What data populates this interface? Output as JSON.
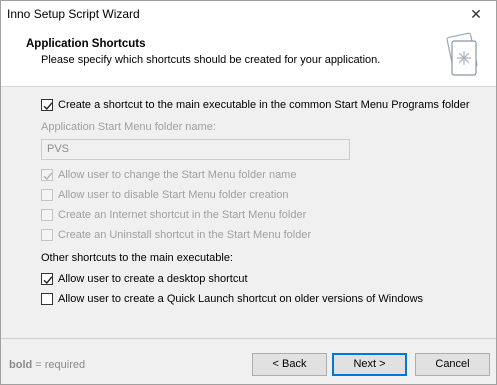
{
  "window": {
    "title": "Inno Setup Script Wizard",
    "close_glyph": "✕"
  },
  "header": {
    "title": "Application Shortcuts",
    "subtitle": "Please specify which shortcuts should be created for your application.",
    "icon": "wizard-page-icon"
  },
  "options": {
    "start_menu_shortcut": {
      "label": "Create a shortcut to the main executable in the common Start Menu Programs folder",
      "checked": true,
      "enabled": true
    },
    "folder_name_label": "Application Start Menu folder name:",
    "folder_name_value": "PVS",
    "allow_change_folder": {
      "label": "Allow user to change the Start Menu folder name",
      "checked": true,
      "enabled": false
    },
    "allow_disable_folder": {
      "label": "Allow user to disable Start Menu folder creation",
      "checked": false,
      "enabled": false
    },
    "internet_shortcut": {
      "label": "Create an Internet shortcut in the Start Menu folder",
      "checked": false,
      "enabled": false
    },
    "uninstall_shortcut": {
      "label": "Create an Uninstall shortcut in the Start Menu folder",
      "checked": false,
      "enabled": false
    },
    "other_shortcuts_label": "Other shortcuts to the main executable:",
    "desktop_shortcut": {
      "label": "Allow user to create a desktop shortcut",
      "checked": true,
      "enabled": true
    },
    "quick_launch_shortcut": {
      "label": "Allow user to create a Quick Launch shortcut on older versions of Windows",
      "checked": false,
      "enabled": true
    }
  },
  "footer": {
    "note_bold": "bold",
    "note_rest": " = required",
    "back_label": "< Back",
    "next_label": "Next >",
    "cancel_label": "Cancel"
  },
  "colors": {
    "accent": "#0078d7",
    "disabled_text": "#a0a0a0"
  }
}
